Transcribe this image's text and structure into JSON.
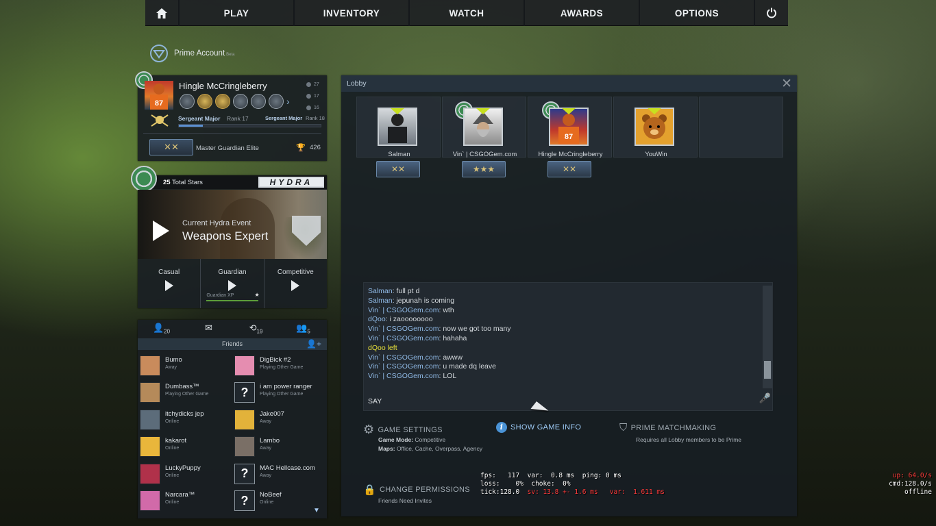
{
  "nav": {
    "items": [
      "PLAY",
      "INVENTORY",
      "WATCH",
      "AWARDS",
      "OPTIONS"
    ],
    "home_icon": "home-icon",
    "power_icon": "power-icon"
  },
  "prime": {
    "label": "Prime Account",
    "beta": "Beta"
  },
  "profile": {
    "name": "Hingle McCringleberry",
    "stats": [
      "27",
      "17",
      "16"
    ],
    "rank_label": "Sergeant Major",
    "rank_num": "Rank 17",
    "next_rank_label": "Sergeant Major",
    "next_rank_num": "Rank 18",
    "xp_fraction": 0.17,
    "skill_group": "Master Guardian Elite",
    "wins": "426"
  },
  "hydra": {
    "total_stars": "25",
    "total_stars_label": "Total Stars",
    "logo": "HYDRA",
    "event_label": "Current Hydra Event",
    "event_name": "Weapons Expert",
    "modes": [
      "Casual",
      "Guardian",
      "Competitive"
    ],
    "guardian_xp": "Guardian XP"
  },
  "friends": {
    "tabs": [
      {
        "icon": "friends-icon",
        "count": "20"
      },
      {
        "icon": "mail-icon",
        "count": ""
      },
      {
        "icon": "history-icon",
        "count": "19"
      },
      {
        "icon": "group-icon",
        "count": "5"
      }
    ],
    "title": "Friends",
    "list": [
      {
        "name": "Bumo",
        "status": "Away",
        "unknown": false
      },
      {
        "name": "DigBick #2",
        "status": "Playing Other Game",
        "unknown": false
      },
      {
        "name": "Dumbass™",
        "status": "Playing Other Game",
        "unknown": false
      },
      {
        "name": "i am power ranger",
        "status": "Playing Other Game",
        "unknown": true
      },
      {
        "name": "itchydicks jep",
        "status": "Online",
        "unknown": false
      },
      {
        "name": "Jake007",
        "status": "Away",
        "unknown": false
      },
      {
        "name": "kakarot",
        "status": "Online",
        "unknown": false
      },
      {
        "name": "Lambo",
        "status": "Away",
        "unknown": false
      },
      {
        "name": "LuckyPuppy",
        "status": "Online",
        "unknown": false
      },
      {
        "name": "MAC Hellcase.com",
        "status": "Away",
        "unknown": true
      },
      {
        "name": "Narcara™",
        "status": "Online",
        "unknown": false
      },
      {
        "name": "NoBeef",
        "status": "Online",
        "unknown": true
      }
    ]
  },
  "lobby": {
    "title": "Lobby",
    "members": [
      {
        "name": "Salman",
        "leader": true
      },
      {
        "name": "Vin` | CSGOGem.com",
        "leader": true
      },
      {
        "name": "Hingle McCringleberry",
        "leader": true
      },
      {
        "name": "YouWin",
        "leader": true
      },
      {
        "name": "",
        "leader": false
      }
    ],
    "chat": [
      {
        "who": "Salman",
        "msg": ": full pt d",
        "sys": false
      },
      {
        "who": "Salman",
        "msg": ": jepunah is coming",
        "sys": false
      },
      {
        "who": "Vin` | CSGOGem.com",
        "msg": ": wth",
        "sys": false
      },
      {
        "who": "dQoo",
        "msg": ": i zaoooooooo",
        "sys": false
      },
      {
        "who": "Vin` | CSGOGem.com",
        "msg": ": now we got too many",
        "sys": false
      },
      {
        "who": "Vin` | CSGOGem.com",
        "msg": ": hahaha",
        "sys": false
      },
      {
        "who": "",
        "msg": "dQoo left",
        "sys": true
      },
      {
        "who": "Vin` | CSGOGem.com",
        "msg": ": awww",
        "sys": false
      },
      {
        "who": "Vin` | CSGOGem.com",
        "msg": ": u made dq leave",
        "sys": false
      },
      {
        "who": "Vin` | CSGOGem.com",
        "msg": ": LOL",
        "sys": false
      }
    ],
    "say": "SAY",
    "game_settings": "GAME SETTINGS",
    "game_mode_label": "Game Mode:",
    "game_mode": "Competitive",
    "maps_label": "Maps:",
    "maps": "Office, Cache, Overpass, Agency",
    "show_info": "SHOW GAME INFO",
    "prime_mm": "PRIME MATCHMAKING",
    "prime_mm_sub": "Requires all Lobby members to be Prime",
    "permissions": "CHANGE PERMISSIONS",
    "permissions_sub": "Friends Need Invites"
  },
  "netgraph": {
    "line1": "fps:   117  var:  0.8 ms  ping: 0 ms",
    "line2": "loss:    0%  choke:  0%",
    "line3a": "tick:128.0  ",
    "line3b": "sv: 13.8 +- 1.6 ms   var:  1.611 ms",
    "up": "up: 64.0/s",
    "cmd": "cmd:128.0/s",
    "status": "offline"
  }
}
